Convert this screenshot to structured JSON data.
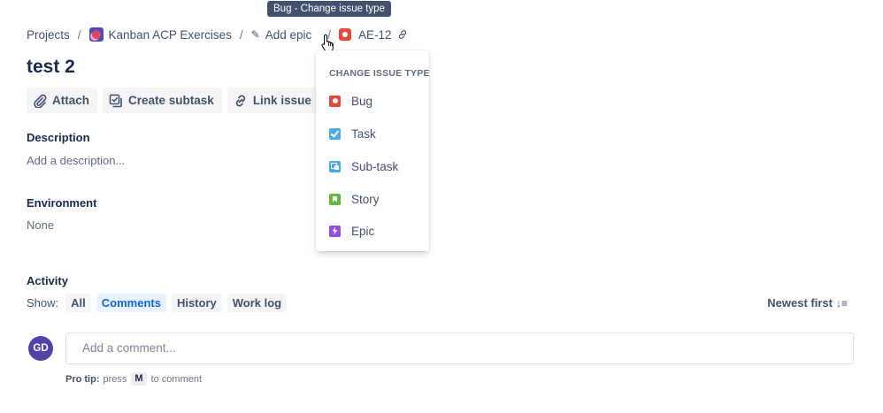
{
  "tooltip": "Bug - Change issue type",
  "breadcrumb": {
    "projects": "Projects",
    "separator": "/",
    "project_name": "Kanban ACP Exercises",
    "add_epic": "Add epic",
    "issue_key": "AE-12",
    "issue_type_icon": "bug-icon"
  },
  "issue": {
    "title": "test 2"
  },
  "actions": {
    "attach": "Attach",
    "create_subtask": "Create subtask",
    "link_issue": "Link issue"
  },
  "description": {
    "label": "Description",
    "placeholder": "Add a description..."
  },
  "environment": {
    "label": "Environment",
    "value": "None"
  },
  "activity": {
    "label": "Activity",
    "show_label": "Show:",
    "filters": [
      "All",
      "Comments",
      "History",
      "Work log"
    ],
    "active_filter": "Comments",
    "sort": "Newest first"
  },
  "comment": {
    "avatar_initials": "GD",
    "placeholder": "Add a comment...",
    "protip_prefix": "Pro tip:",
    "protip_press": "press",
    "protip_key": "M",
    "protip_suffix": "to comment"
  },
  "dropdown": {
    "heading": "CHANGE ISSUE TYPE",
    "items": [
      {
        "label": "Bug",
        "icon": "bug-icon",
        "color": "#E5493A"
      },
      {
        "label": "Task",
        "icon": "task-icon",
        "color": "#4BADE8"
      },
      {
        "label": "Sub-task",
        "icon": "subtask-icon",
        "color": "#4BADE8"
      },
      {
        "label": "Story",
        "icon": "story-icon",
        "color": "#63BA3C"
      },
      {
        "label": "Epic",
        "icon": "epic-icon",
        "color": "#904EE2"
      }
    ]
  },
  "colors": {
    "accent": "#0C66E4",
    "avatar": "#5243AA",
    "tooltip_bg": "#42526E"
  }
}
